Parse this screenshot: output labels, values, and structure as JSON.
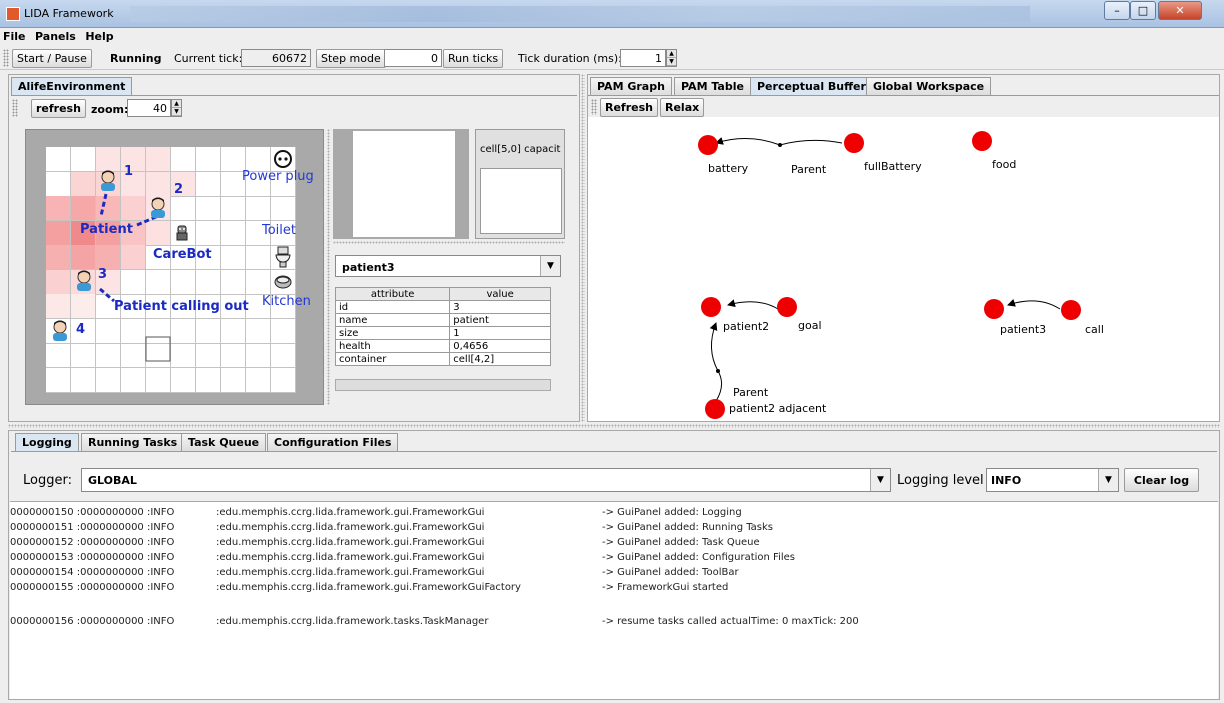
{
  "window": {
    "title": "LIDA Framework"
  },
  "menu": [
    "File",
    "Panels",
    "Help"
  ],
  "toolbar": {
    "start_pause": "Start / Pause",
    "status": "Running",
    "current_tick_label": "Current tick:",
    "current_tick": "60672",
    "step_mode": "Step mode",
    "run_ticks_value": "0",
    "run_ticks": "Run ticks",
    "tick_duration_label": "Tick duration (ms):",
    "tick_duration": "1"
  },
  "left_panel": {
    "tab": "AlifeEnvironment",
    "refresh": "refresh",
    "zoom_label": "zoom:",
    "zoom": "40",
    "env_labels": {
      "n1": "1",
      "n2": "2",
      "n3": "3",
      "n4": "4",
      "patient": "Patient",
      "carebot": "CareBot",
      "calling": "Patient calling out",
      "power_plug": "Power plug",
      "toilet": "Toilet",
      "kitchen": "Kitchen"
    },
    "cell_capacity": "cell[5,0] capacit",
    "selected_object": "patient3",
    "table": {
      "headers": [
        "attribute",
        "value"
      ],
      "rows": [
        [
          "id",
          "3"
        ],
        [
          "name",
          "patient"
        ],
        [
          "size",
          "1"
        ],
        [
          "health",
          "0,4656"
        ],
        [
          "container",
          "cell[4,2]"
        ]
      ]
    }
  },
  "right_panel": {
    "tabs": [
      "PAM Graph",
      "PAM Table",
      "Perceptual Buffer",
      "Global Workspace"
    ],
    "selected_tab": "Perceptual Buffer",
    "refresh": "Refresh",
    "relax": "Relax",
    "graph_labels": {
      "battery": "battery",
      "parent1": "Parent",
      "fullBattery": "fullBattery",
      "food": "food",
      "patient2": "patient2",
      "goal": "goal",
      "patient3": "patient3",
      "call": "call",
      "parent2": "Parent",
      "patient2_adjacent": "patient2 adjacent"
    }
  },
  "bottom_panel": {
    "tabs": [
      "Logging",
      "Running Tasks",
      "Task Queue",
      "Configuration Files"
    ],
    "selected_tab": "Logging",
    "logger_label": "Logger:",
    "logger_value": "GLOBAL",
    "level_label": "Logging level",
    "level_value": "INFO",
    "clear_log": "Clear log",
    "log": [
      {
        "id": "0000000150 :0000000000 :INFO",
        "src": ":edu.memphis.ccrg.lida.framework.gui.FrameworkGui",
        "msg": "-> GuiPanel added: Logging"
      },
      {
        "id": "0000000151 :0000000000 :INFO",
        "src": ":edu.memphis.ccrg.lida.framework.gui.FrameworkGui",
        "msg": "-> GuiPanel added: Running Tasks"
      },
      {
        "id": "0000000152 :0000000000 :INFO",
        "src": ":edu.memphis.ccrg.lida.framework.gui.FrameworkGui",
        "msg": "-> GuiPanel added: Task Queue"
      },
      {
        "id": "0000000153 :0000000000 :INFO",
        "src": ":edu.memphis.ccrg.lida.framework.gui.FrameworkGui",
        "msg": "-> GuiPanel added: Configuration Files"
      },
      {
        "id": "0000000154 :0000000000 :INFO",
        "src": ":edu.memphis.ccrg.lida.framework.gui.FrameworkGui",
        "msg": "-> GuiPanel added: ToolBar"
      },
      {
        "id": "0000000155 :0000000000 :INFO",
        "src": ":edu.memphis.ccrg.lida.framework.gui.FrameworkGuiFactory",
        "msg": "-> FrameworkGui started"
      },
      {
        "id": "0000000156 :0000000000 :INFO",
        "src": ":edu.memphis.ccrg.lida.framework.tasks.TaskManager",
        "msg": "-> resume tasks called actualTime: 0 maxTick: 200"
      }
    ]
  },
  "colors": {
    "node": "#ee0000",
    "heat": "#f08a8a",
    "label": "#1a2ac2"
  }
}
